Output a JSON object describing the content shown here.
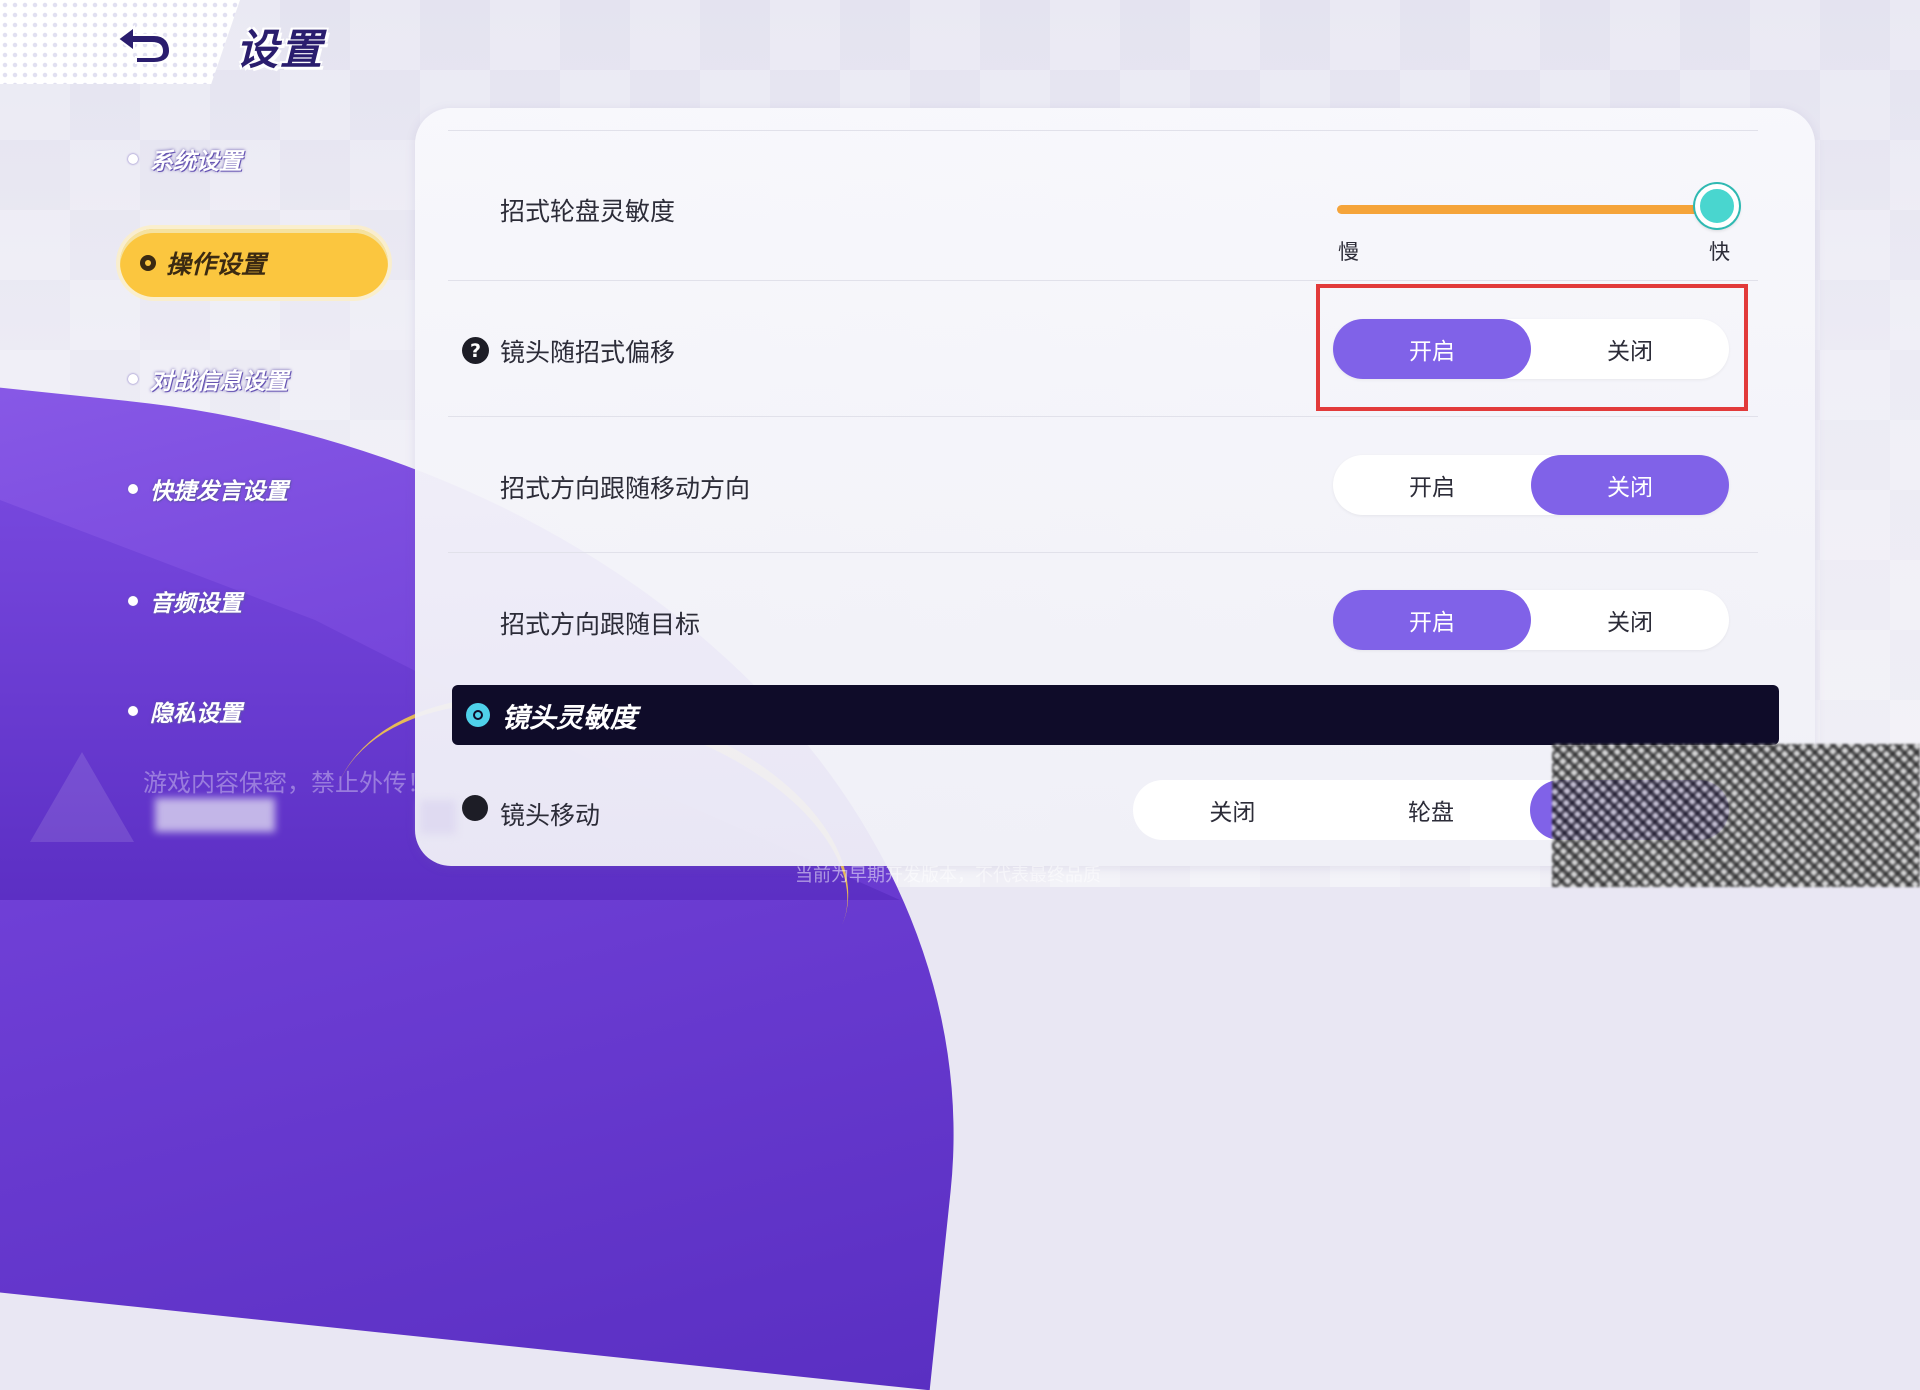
{
  "header": {
    "title": "设置",
    "back_icon": "back-arrow-icon"
  },
  "sidebar": {
    "items": [
      {
        "label": "系统设置",
        "active": false
      },
      {
        "label": "操作设置",
        "active": true
      },
      {
        "label": "对战信息设置",
        "active": false
      },
      {
        "label": "快捷发言设置",
        "active": false
      },
      {
        "label": "音频设置",
        "active": false
      },
      {
        "label": "隐私设置",
        "active": false
      }
    ]
  },
  "settings": {
    "wheel_sensitivity": {
      "label": "招式轮盘灵敏度",
      "min_label": "慢",
      "max_label": "快",
      "value": 1.0
    },
    "camera_follow": {
      "label": "镜头随招式偏移",
      "on": "开启",
      "off": "关闭",
      "selected": "开启"
    },
    "direction_follow_move": {
      "label": "招式方向跟随移动方向",
      "on": "开启",
      "off": "关闭",
      "selected": "关闭"
    },
    "direction_follow_target": {
      "label": "招式方向跟随目标",
      "on": "开启",
      "off": "关闭",
      "selected": "开启"
    }
  },
  "camera_section": {
    "title": "镜头灵敏度",
    "camera_move": {
      "label": "镜头移动",
      "options": [
        "关闭",
        "轮盘"
      ]
    }
  },
  "watermark": {
    "warning": "游戏内容保密，禁止外传！",
    "bottom_notice": "当前为早期开发版本，不代表最终品质"
  },
  "colors": {
    "accent": "#8062e8",
    "active_tab": "#fbc63f",
    "highlight": "#e23a3a",
    "slider": "#f5a43a",
    "knob": "#49d6cf"
  }
}
